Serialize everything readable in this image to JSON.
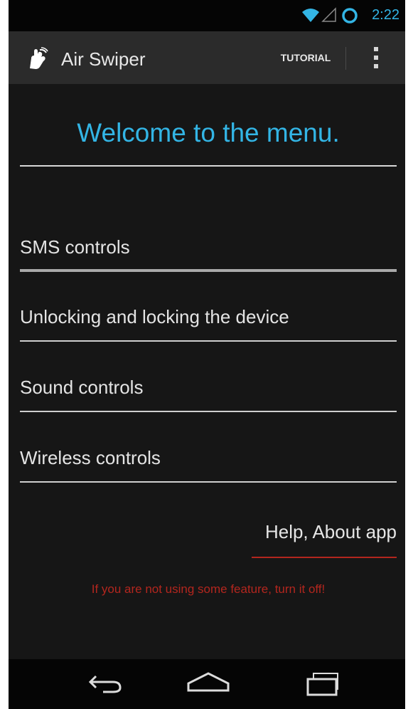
{
  "status_bar": {
    "time": "2:22",
    "icons": [
      "wifi-icon",
      "cell-signal-icon",
      "sync-icon"
    ],
    "accent": "#33b5e5"
  },
  "action_bar": {
    "app_icon": "hand-icon",
    "title": "Air Swiper",
    "tutorial_label": "TUTORIAL",
    "overflow_icon": "overflow-menu-icon"
  },
  "content": {
    "welcome": "Welcome to the menu.",
    "menu_items": [
      {
        "label": "SMS controls"
      },
      {
        "label": "Unlocking and locking the device"
      },
      {
        "label": "Sound controls"
      },
      {
        "label": "Wireless controls"
      }
    ],
    "help_label": "Help, About app",
    "warning": "If you are not using some feature, turn it off!"
  },
  "nav_bar": {
    "icons": [
      "back-icon",
      "home-icon",
      "recent-apps-icon"
    ]
  },
  "colors": {
    "accent_blue": "#33b5e5",
    "warning_red": "#b3261e",
    "background": "#161616",
    "action_bar": "#2b2b2b"
  }
}
